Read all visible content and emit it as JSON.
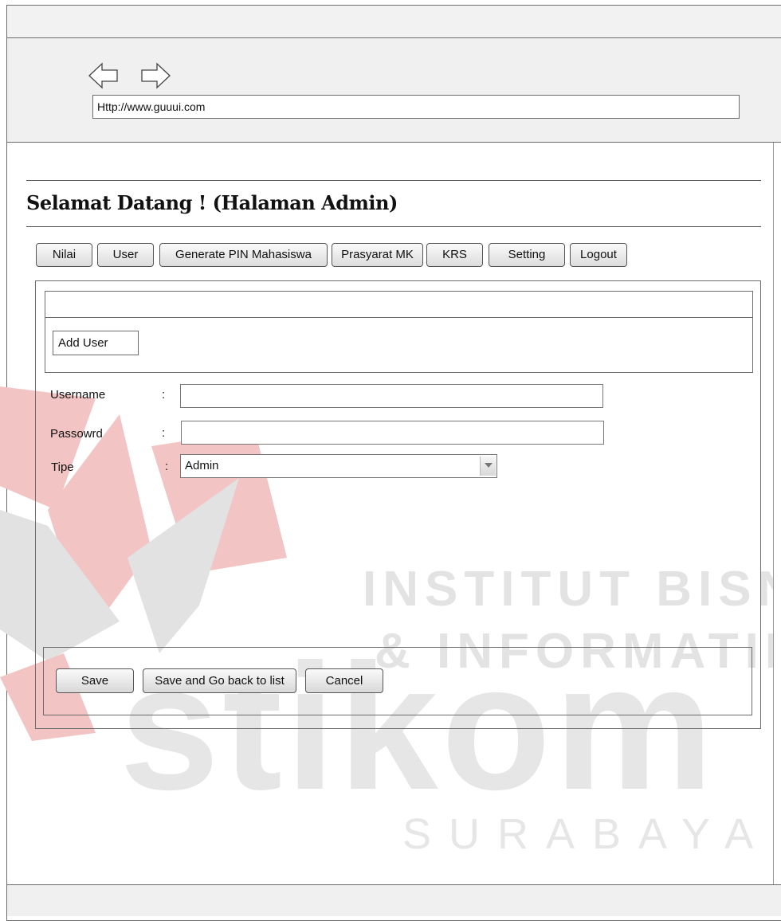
{
  "browser": {
    "url": "Http://www.guuui.com"
  },
  "header": {
    "title": "Selamat Datang ! (Halaman Admin)"
  },
  "nav": {
    "items": [
      {
        "label": "Nilai"
      },
      {
        "label": "User"
      },
      {
        "label": "Generate PIN Mahasiswa"
      },
      {
        "label": "Prasyarat MK"
      },
      {
        "label": "KRS"
      },
      {
        "label": "Setting"
      },
      {
        "label": "Logout"
      }
    ]
  },
  "form": {
    "section_label": "Add User",
    "fields": [
      {
        "label": "Username",
        "colon": ":",
        "value": ""
      },
      {
        "label": "Passowrd",
        "colon": ":",
        "value": ""
      },
      {
        "label": "Tipe",
        "colon": ":",
        "value": "Admin"
      }
    ]
  },
  "actions": {
    "save": "Save",
    "save_back": "Save and Go back to list",
    "cancel": "Cancel"
  },
  "watermark": {
    "line1": "INSTITUT BISNIS",
    "line2": "& INFORMATIKA",
    "brand": "stikom",
    "city": "SURABAYA"
  },
  "colors": {
    "watermark_red": "#f2c4c4",
    "watermark_gray": "#e3e3e3"
  }
}
